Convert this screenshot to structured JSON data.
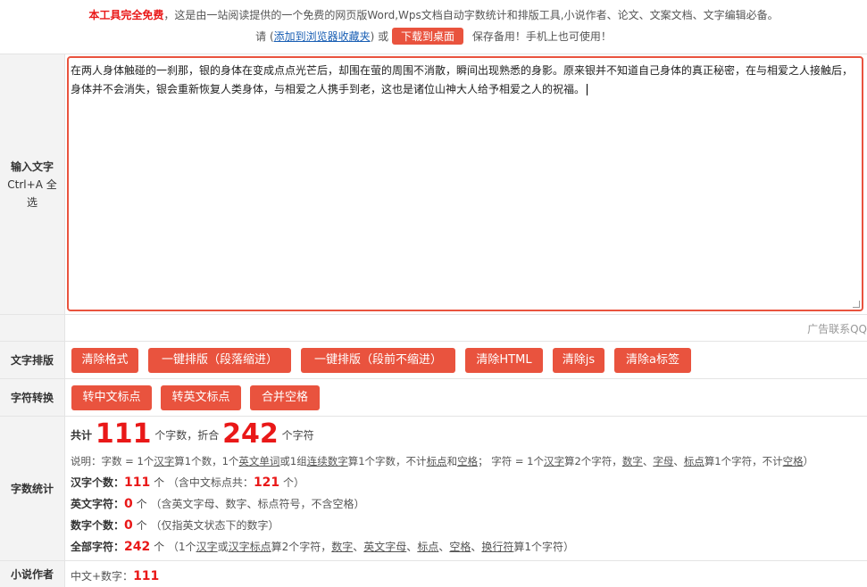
{
  "header": {
    "free_label": "本工具完全免费",
    "intro": "，这是由一站阅读提供的一个免费的网页版Word,Wps文档自动字数统计和排版工具,小说作者、论文、文案文档、文字编辑必备。",
    "please": "请",
    "bookmark_link": "添加到浏览器收藏夹",
    "or": "或",
    "download_button": "下载到桌面",
    "save_note": "保存备用！手机上也可使用！"
  },
  "input_row": {
    "label_line1": "输入文字",
    "label_line2": "Ctrl+A 全",
    "label_line3": "选",
    "text": "在两人身体触碰的一刹那，银的身体在变成点点光芒后，却围在萤的周围不消散，瞬间出现熟悉的身影。原来银并不知道自己身体的真正秘密，在与相爱之人接触后，身体并不会消失，银会重新恢复人类身体，与相爱之人携手到老，这也是诸位山神大人给予相爱之人的祝福。"
  },
  "ad_row": {
    "text": "广告联系QQ"
  },
  "layout_row": {
    "label": "文字排版",
    "buttons": [
      "清除格式",
      "一键排版（段落缩进）",
      "一键排版（段前不缩进）",
      "清除HTML",
      "清除js",
      "清除a标签"
    ]
  },
  "convert_row": {
    "label": "字符转换",
    "buttons": [
      "转中文标点",
      "转英文标点",
      "合并空格"
    ]
  },
  "stats_row": {
    "label": "字数统计",
    "total_prefix": "共计",
    "total_words": "111",
    "total_unit": "个字数，折合",
    "total_chars": "242",
    "total_chars_unit": "个字符",
    "note_parts": [
      "说明：字数 = 1个",
      "汉字",
      "算1个数，1个",
      "英文单词",
      "或1组",
      "连续数字",
      "算1个字数，不计",
      "标点",
      "和",
      "空格",
      "；  字符 = 1个",
      "汉字",
      "算2个字符，",
      "数字",
      "、",
      "字母",
      "、",
      "标点",
      "算1个字符，不计",
      "空格",
      "）"
    ],
    "hanzi_label": "汉字个数：",
    "hanzi_count": "111",
    "hanzi_unit": "个",
    "hanzi_note": "（含中文标点共：",
    "hanzi_punct_count": "121",
    "hanzi_note_end": "个）",
    "eng_label": "英文字符：",
    "eng_count": "0",
    "eng_unit": "个",
    "eng_note": "（含英文字母、数字、标点符号，不含空格）",
    "num_label": "数字个数：",
    "num_count": "0",
    "num_unit": "个",
    "num_note": "（仅指英文状态下的数字）",
    "all_label": "全部字符：",
    "all_count": "242",
    "all_unit": "个",
    "all_note_parts": [
      "（1个",
      "汉字",
      "或",
      "汉字标点",
      "算2个字符，",
      "数字",
      "、",
      "英文字母",
      "、",
      "标点",
      "、",
      "空格",
      "、",
      "换行符",
      "算1个字符）"
    ]
  },
  "novel_row": {
    "label": "小说作者",
    "text": "中文+数字：",
    "count": "111"
  },
  "colors": {
    "accent": "#e9533e",
    "highlight": "#e91818",
    "label_bg": "#f3f3f3"
  }
}
